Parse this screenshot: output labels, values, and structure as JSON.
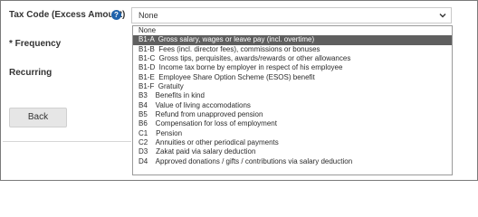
{
  "form": {
    "tax_code_label": "Tax Code (Excess Amount)",
    "help_icon": "?",
    "frequency_label": "* Frequency",
    "recurring_label": "Recurring",
    "back_label": "Back"
  },
  "select": {
    "value": "None",
    "icon": "chevron-down-icon"
  },
  "dropdown": {
    "options": [
      "None",
      "B1-A  Gross salary, wages or leave pay (incl. overtime)",
      "B1-B  Fees (incl. director fees), commissions or bonuses",
      "B1-C  Gross tips, perquisites, awards/rewards or other allowances",
      "B1-D  Income tax borne by employer in respect of his employee",
      "B1-E  Employee Share Option Scheme (ESOS) benefit",
      "B1-F  Gratuity",
      "B3    Benefits in kind",
      "B4    Value of living accomodations",
      "B5    Refund from unapproved pension",
      "B6    Compensation for loss of employment",
      "C1    Pension",
      "C2    Annuities or other periodical payments",
      "D3    Zakat paid via salary deduction",
      "D4    Approved donations / gifts / contributions via salary deduction"
    ],
    "selected_index": 1
  },
  "colors": {
    "help_icon": "#1f62ab",
    "selected_bg": "#5f5f5f",
    "button_bg": "#e6e6e6"
  }
}
